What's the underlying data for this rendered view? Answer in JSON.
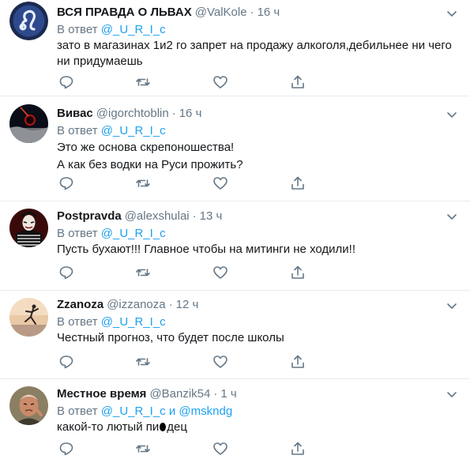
{
  "reply_prefix": "В ответ",
  "tweets": [
    {
      "name": "ВСЯ ПРАВДА О ЛЬВАХ",
      "handle": "@ValKole",
      "dot": "·",
      "time": "16 ч",
      "mentions": [
        "@_U_R_I_c"
      ],
      "text_lines": [
        "зато в магазинах 1и2 го запрет на продажу алкоголя,дебильнее ни чего",
        "ни придумаешь"
      ],
      "avatar_icon": "leo-zodiac-icon"
    },
    {
      "name": "Вивас",
      "handle": "@igorchtoblin",
      "dot": "·",
      "time": "16 ч",
      "mentions": [
        "@_U_R_I_c"
      ],
      "text_lines": [
        "Это же основа скрепоношества!",
        "А как без водки на Руси прожить?"
      ],
      "avatar_icon": "eclipse-photo-icon"
    },
    {
      "name": "Postpravda",
      "handle": "@alexshulai",
      "dot": "·",
      "time": "13 ч",
      "mentions": [
        "@_U_R_I_c"
      ],
      "text_lines": [
        "Пусть бухают!!! Главное чтобы на митинги не ходили!!"
      ],
      "avatar_icon": "masked-figure-icon"
    },
    {
      "name": "Zzanoza",
      "handle": "@izzanoza",
      "dot": "·",
      "time": "12 ч",
      "mentions": [
        "@_U_R_I_c"
      ],
      "text_lines": [
        "Честный прогноз, что будет после школы"
      ],
      "avatar_icon": "sunset-runner-icon"
    },
    {
      "name": "Местное время",
      "handle": "@Banzik54",
      "dot": "·",
      "time": "1 ч",
      "mentions": [
        "@_U_R_I_c",
        "@mskndg"
      ],
      "mention_joiner": "и",
      "text_before_censor": "какой-то лютый пи",
      "text_after_censor": "дец",
      "avatar_icon": "old-man-portrait-icon"
    }
  ],
  "colors": {
    "link": "#1da1f2",
    "secondary": "#657786",
    "divider": "#e6ecf0",
    "text": "#14171a"
  }
}
